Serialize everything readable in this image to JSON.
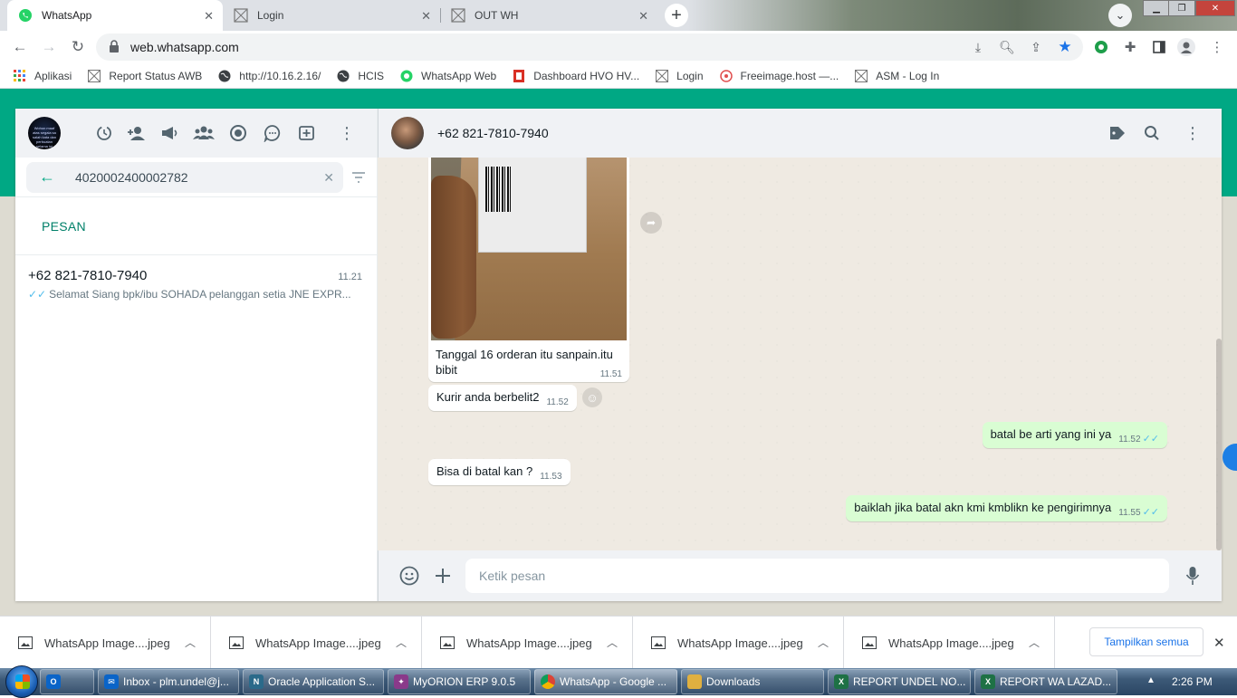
{
  "browser": {
    "tabs": [
      {
        "title": "WhatsApp",
        "icon": "whatsapp-icon",
        "active": true
      },
      {
        "title": "Login",
        "icon": "page-icon",
        "active": false
      },
      {
        "title": "OUT WH",
        "icon": "page-icon",
        "active": false
      }
    ],
    "url": "web.whatsapp.com",
    "bookmarks": [
      {
        "label": "Aplikasi",
        "icon": "apps-grid-icon"
      },
      {
        "label": "Report Status AWB",
        "icon": "page-icon"
      },
      {
        "label": "http://10.16.2.16/",
        "icon": "globe-icon"
      },
      {
        "label": "HCIS",
        "icon": "globe-icon"
      },
      {
        "label": "WhatsApp Web",
        "icon": "whatsapp-icon"
      },
      {
        "label": "Dashboard HVO HV...",
        "icon": "dashboard-icon"
      },
      {
        "label": "Login",
        "icon": "page-icon"
      },
      {
        "label": "Freeimage.host —...",
        "icon": "freeimage-icon"
      },
      {
        "label": "ASM - Log In",
        "icon": "page-icon"
      }
    ]
  },
  "whatsapp": {
    "search": {
      "value": "4020002400002782"
    },
    "section_label": "PESAN",
    "results": [
      {
        "name": "+62 821-7810-7940",
        "time": "11.21",
        "preview": "Selamat Siang   bpk/ibu SOHADA pelanggan setia JNE EXPR..."
      }
    ],
    "my_avatar_text": "Wohon maaf atas segala sa salah kata dan perbuatan selama ini",
    "chat": {
      "contact": "+62 821-7810-7940",
      "messages": [
        {
          "dir": "in",
          "type": "image",
          "caption": "Tanggal 16 orderan itu sanpain.itu bibit",
          "time": "11.51"
        },
        {
          "dir": "in",
          "type": "text",
          "text": "Kurir anda berbelit2",
          "time": "11.52"
        },
        {
          "dir": "out",
          "type": "text",
          "text": "batal be arti yang ini ya",
          "time": "11.52"
        },
        {
          "dir": "in",
          "type": "text",
          "text": "Bisa di batal kan ?",
          "time": "11.53"
        },
        {
          "dir": "out",
          "type": "text",
          "text": "baiklah jika batal akn kmi kmblikn ke pengirimnya",
          "time": "11.55"
        }
      ],
      "composer_placeholder": "Ketik pesan"
    }
  },
  "downloads": {
    "items": [
      "WhatsApp Image....jpeg",
      "WhatsApp Image....jpeg",
      "WhatsApp Image....jpeg",
      "WhatsApp Image....jpeg",
      "WhatsApp Image....jpeg"
    ],
    "show_all": "Tampilkan semua"
  },
  "taskbar": {
    "items": [
      {
        "label": "Inbox - plm.undel@j...",
        "icon": "outlook-icon",
        "color": "#0a64c8"
      },
      {
        "label": "Oracle Application S...",
        "icon": "oracle-icon",
        "color": "#2b6a8a"
      },
      {
        "label": "MyORION ERP 9.0.5",
        "icon": "orion-icon",
        "color": "#8a3a8a"
      },
      {
        "label": "WhatsApp - Google ...",
        "icon": "chrome-icon",
        "color": "#db4437"
      },
      {
        "label": "Downloads",
        "icon": "folder-icon",
        "color": "#e0b040"
      },
      {
        "label": "REPORT UNDEL NO...",
        "icon": "excel-icon",
        "color": "#1e7145"
      },
      {
        "label": "REPORT WA LAZAD...",
        "icon": "excel-icon",
        "color": "#1e7145"
      }
    ],
    "clock": "2:26 PM"
  },
  "colors": {
    "whatsapp_green": "#00a884",
    "outgoing_bubble": "#d9fdd3",
    "read_tick": "#53bdeb"
  }
}
